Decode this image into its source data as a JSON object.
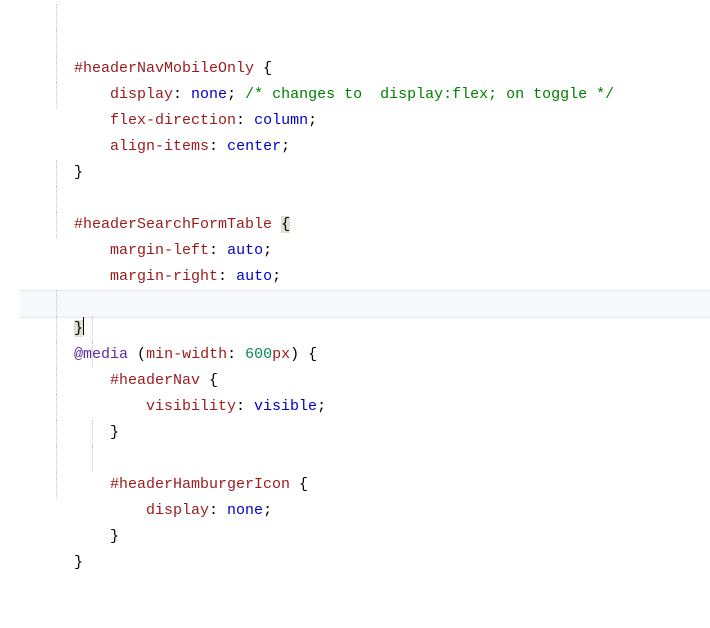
{
  "lines": {
    "l1_sel": "#headerNavMobileOnly",
    "l1_brace": " {",
    "l2_prop": "display",
    "l2_colon": ": ",
    "l2_val": "none",
    "l2_semi": "; ",
    "l2_comm": "/* changes to  display:flex; on toggle */",
    "l3_prop": "flex-direction",
    "l3_colon": ": ",
    "l3_val": "column",
    "l3_semi": ";",
    "l4_prop": "align-items",
    "l4_colon": ": ",
    "l4_val": "center",
    "l4_semi": ";",
    "l5_brace": "}",
    "l7_sel": "#headerSearchFormTable",
    "l7_brace_sp": " ",
    "l7_brace": "{",
    "l8_prop": "margin-left",
    "l8_colon": ": ",
    "l8_val": "auto",
    "l8_semi": ";",
    "l9_prop": "margin-right",
    "l9_colon": ": ",
    "l9_val": "auto",
    "l9_semi": ";",
    "l10_brace": "}",
    "l12_at": "@media",
    "l12_sp": " ",
    "l12_paren_o": "(",
    "l12_feat": "min-width",
    "l12_colon": ": ",
    "l12_num": "600",
    "l12_unit": "px",
    "l12_paren_c": ")",
    "l12_brace": " {",
    "l13_sel": "#headerNav",
    "l13_brace": " {",
    "l14_prop": "visibility",
    "l14_colon": ": ",
    "l14_val": "visible",
    "l14_semi": ";",
    "l15_brace": "}",
    "l17_sel": "#headerHamburgerIcon",
    "l17_brace": " {",
    "l18_prop": "display",
    "l18_colon": ": ",
    "l18_val": "none",
    "l18_semi": ";",
    "l19_brace": "}",
    "l20_brace": "}"
  }
}
